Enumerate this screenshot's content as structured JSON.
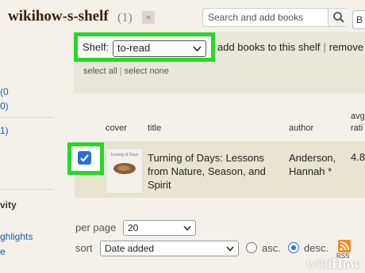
{
  "header": {
    "shelf_title": "wikihow-s-shelf",
    "count": "(1)",
    "close_glyph": "×",
    "search_placeholder": "Search and add books",
    "right_tab": "B"
  },
  "sidebar": {
    "items": [
      {
        "text": "(0",
        "style": "link"
      },
      {
        "text": "0)",
        "style": "link"
      },
      {
        "text": "1)",
        "style": "link"
      },
      {
        "text": "vity",
        "style": "heading"
      },
      {
        "text": "ghlights",
        "style": "link"
      },
      {
        "text": "e",
        "style": "link"
      }
    ]
  },
  "toolbar": {
    "shelf_label": "Shelf:",
    "shelf_value": "to-read",
    "add_books": "add books to this shelf",
    "remove_books": "remove b",
    "select_all": "select all",
    "select_none": "select none"
  },
  "table": {
    "columns": [
      "cover",
      "title",
      "author",
      "avg",
      "rati"
    ],
    "rows": [
      {
        "checked": true,
        "cover_text": "Turning of Days",
        "title": "Turning of Days: Lessons from Nature, Season, and Spirit",
        "author": "Anderson, Hannah *",
        "rating": "4.8"
      }
    ]
  },
  "footer": {
    "per_page_label": "per page",
    "per_page_value": "20",
    "sort_label": "sort",
    "sort_value": "Date added",
    "asc_label": "asc.",
    "desc_label": "desc.",
    "sort_direction": "desc",
    "rss_label": "RSS"
  },
  "watermark": {
    "prefix": "wiki",
    "suffix": "How"
  },
  "colors": {
    "highlight": "#27d827",
    "accent": "#2a6fd6",
    "row_bg": "#e9e4cf",
    "toolbar_bg": "#e9e6da"
  },
  "icons": [
    "search-icon",
    "close-icon",
    "chevron-down-icon",
    "check-icon",
    "rss-icon"
  ]
}
